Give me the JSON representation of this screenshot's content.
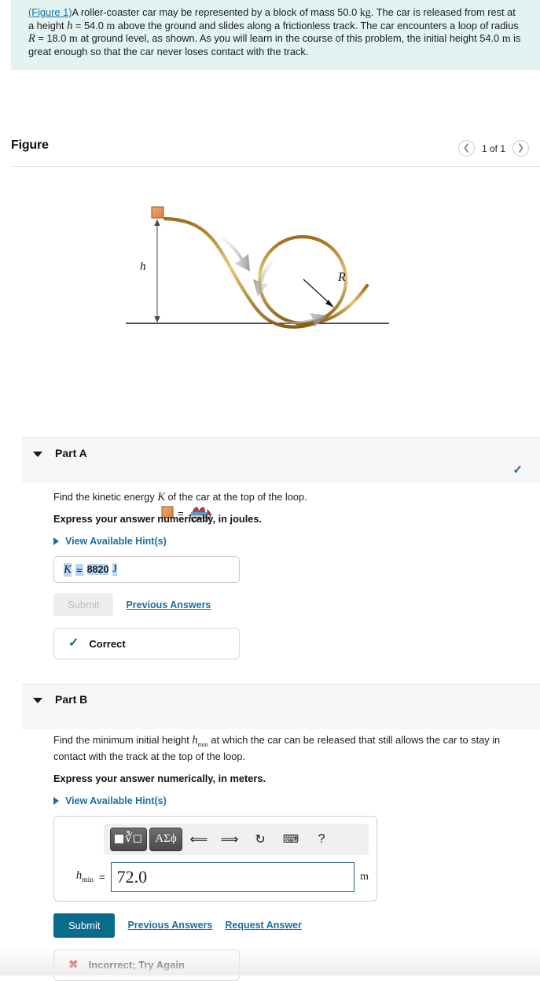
{
  "statement": {
    "figure_link": "(Figure 1)",
    "text_1": "A roller-coaster car may be represented by a block of mass 50.0 ",
    "unit_kg": "kg",
    "text_2": ". The car is released from rest at a height ",
    "var_h": "h",
    "text_3": " = 54.0 ",
    "unit_m1": "m",
    "text_4": " above the ground and slides along a frictionless track. The car encounters a loop of radius ",
    "var_R": "R",
    "text_5": " = 18.0 ",
    "unit_m2": "m",
    "text_6": " at ground level, as shown. As you will learn in the course of this problem, the initial height 54.0 ",
    "unit_m3": "m",
    "text_7": " is great enough so that the car never loses contact with the track."
  },
  "figure": {
    "title": "Figure",
    "prev_icon": "chevron-left-icon",
    "next_icon": "chevron-right-icon",
    "counter": "1 of 1",
    "label_h": "h",
    "label_R": "R",
    "legend_equals": "="
  },
  "part_a": {
    "label": "Part A",
    "status_icon": "check-icon",
    "status_color": "#156a7e",
    "question": "Find the kinetic energy ",
    "question_var": "K",
    "question_tail": " of the car at the top of the loop.",
    "instruction": "Express your answer numerically, in joules.",
    "hints_label": "View Available Hint(s)",
    "answer_var": "K",
    "answer_eq": "=",
    "answer_value": "8820",
    "answer_unit": "J",
    "submit_label": "Submit",
    "previous_answers_label": "Previous Answers",
    "feedback_icon": "check-icon",
    "feedback_text": "Correct",
    "feedback_color": "#117a3d"
  },
  "part_b": {
    "label": "Part B",
    "question": "Find the minimum initial height ",
    "question_var": "h",
    "question_sub": "min",
    "question_tail": " at which the car can be released that still allows the car to stay in contact with the track at the top of the loop.",
    "instruction": "Express your answer numerically, in meters.",
    "hints_label": "View Available Hint(s)",
    "toolbar": [
      {
        "name": "template-root-button",
        "glyph": "√"
      },
      {
        "name": "greek-symbols-button",
        "glyph": "ΑΣϕ"
      },
      {
        "name": "undo-button",
        "glyph": "↶"
      },
      {
        "name": "redo-button",
        "glyph": "↷"
      },
      {
        "name": "reset-button",
        "glyph": "↻"
      },
      {
        "name": "keyboard-button",
        "glyph": "⌨"
      },
      {
        "name": "help-button",
        "glyph": "?"
      }
    ],
    "answer_var": "h",
    "answer_sub": "min",
    "answer_eq": "=",
    "answer_value": "72.0",
    "answer_unit": "m",
    "submit_label": "Submit",
    "previous_answers_label": "Previous Answers",
    "request_answer_label": "Request Answer",
    "feedback_icon": "cross-icon",
    "feedback_text": "Incorrect; Try Again",
    "feedback_color": "#cc2020"
  },
  "colors": {
    "banner_bg": "#e2f3f1",
    "link": "#1b6ea5",
    "section_bg": "#f7f7f7",
    "submit_active": "#0a6b8a",
    "track": "#b07d22",
    "block": "#e58a4e"
  }
}
